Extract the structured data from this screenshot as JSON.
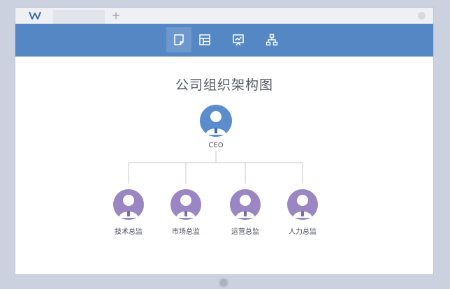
{
  "app": {
    "tab_add": "+",
    "logo_icon": "wps-logo-icon"
  },
  "toolbar": {
    "items": [
      {
        "icon": "document-icon",
        "active": true
      },
      {
        "icon": "table-icon",
        "active": false
      },
      {
        "icon": "presentation-icon",
        "active": false
      },
      {
        "icon": "org-chart-icon",
        "active": false
      }
    ],
    "color": "#5587c4"
  },
  "document": {
    "title": "公司组织架构图"
  },
  "org_chart": {
    "root": {
      "label": "CEO",
      "color": "#5b8ccb"
    },
    "children": [
      {
        "label": "技术总监",
        "color": "#9a86c2"
      },
      {
        "label": "市场总监",
        "color": "#9a86c2"
      },
      {
        "label": "运营总监",
        "color": "#9a86c2"
      },
      {
        "label": "人力总监",
        "color": "#9a86c2"
      }
    ]
  }
}
